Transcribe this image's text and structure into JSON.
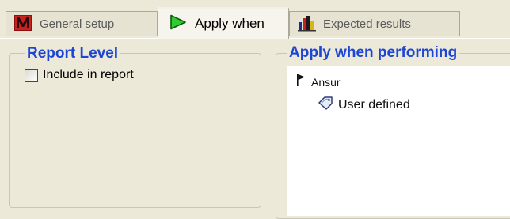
{
  "tabs": [
    {
      "label": "General setup",
      "icon": "m-logo-icon",
      "active": false
    },
    {
      "label": "Apply when",
      "icon": "play-triangle-icon",
      "active": true
    },
    {
      "label": "Expected results",
      "icon": "bar-chart-icon",
      "active": false
    }
  ],
  "report_level": {
    "title": "Report Level",
    "include_in_report": {
      "label": "Include in report",
      "checked": false
    }
  },
  "apply_when": {
    "title": "Apply when performing",
    "tree": {
      "root": {
        "label": "Ansur",
        "icon": "flag-icon"
      },
      "children": [
        {
          "label": "User defined",
          "icon": "tag-icon"
        }
      ]
    }
  },
  "colors": {
    "group_title": "#1d46d4",
    "tab_icon_m": "#b81c1c",
    "tab_icon_play": "#1ea51e",
    "background": "#ece9d8"
  }
}
